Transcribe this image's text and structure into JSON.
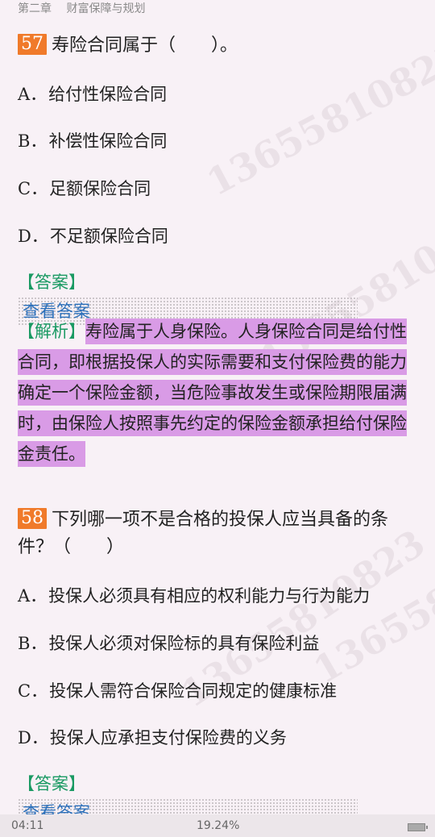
{
  "header": {
    "breadcrumb": "第二章　 财富保障与规划"
  },
  "watermark_text": "13655810823",
  "questions": [
    {
      "number": "57",
      "text": "寿险合同属于（　　）。",
      "options": [
        {
          "letter": "A．",
          "text": "给付性保险合同"
        },
        {
          "letter": "B．",
          "text": "补偿性保险合同"
        },
        {
          "letter": "C．",
          "text": "足额保险合同"
        },
        {
          "letter": "D．",
          "text": "不足额保险合同"
        }
      ],
      "answer_label": "【答案】",
      "answer_action": "查看答案",
      "analysis_label": "【解析】",
      "analysis_text": "寿险属于人身保险。人身保险合同是给付性合同，即根据投保人的实际需要和支付保险费的能力确定一个保险金额，当危险事故发生或保险期限届满时，由保险人按照事先约定的保险金额承担给付保险金责任。"
    },
    {
      "number": "58",
      "text": "下列哪一项不是合格的投保人应当具备的条件？（　　）",
      "options": [
        {
          "letter": "A．",
          "text": "投保人必须具有相应的权利能力与行为能力"
        },
        {
          "letter": "B．",
          "text": "投保人必须对保险标的具有保险利益"
        },
        {
          "letter": "C．",
          "text": "投保人需符合保险合同规定的健康标准"
        },
        {
          "letter": "D．",
          "text": "投保人应承担支付保险费的义务"
        }
      ],
      "answer_label": "【答案】",
      "answer_action": "查看答案"
    }
  ],
  "footer": {
    "time": "04:11",
    "progress": "19.24%"
  },
  "colors": {
    "background": "#f8f1f6",
    "number_badge": "#f07a2a",
    "highlight": "#d99be6",
    "bracket_green": "#1a9a63",
    "link_blue": "#2a6fba"
  }
}
